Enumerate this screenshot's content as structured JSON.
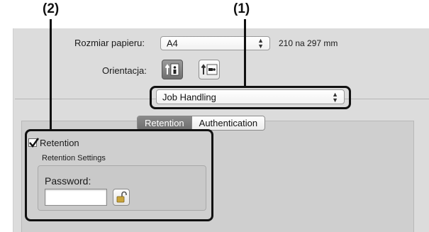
{
  "callouts": {
    "one": "(1)",
    "two": "(2)"
  },
  "paper_size": {
    "label": "Rozmiar papieru:",
    "value": "A4",
    "dimensions": "210 na 297 mm"
  },
  "orientation": {
    "label": "Orientacja:",
    "options": [
      "portrait",
      "landscape"
    ],
    "selected": "portrait"
  },
  "panel_select": {
    "value": "Job Handling"
  },
  "tabs": [
    {
      "label": "Retention",
      "active": true
    },
    {
      "label": "Authentication",
      "active": false
    }
  ],
  "retention": {
    "checkbox_label": "Retention",
    "checked": true,
    "settings_label": "Retention Settings",
    "password_label": "Password:",
    "password_value": ""
  }
}
